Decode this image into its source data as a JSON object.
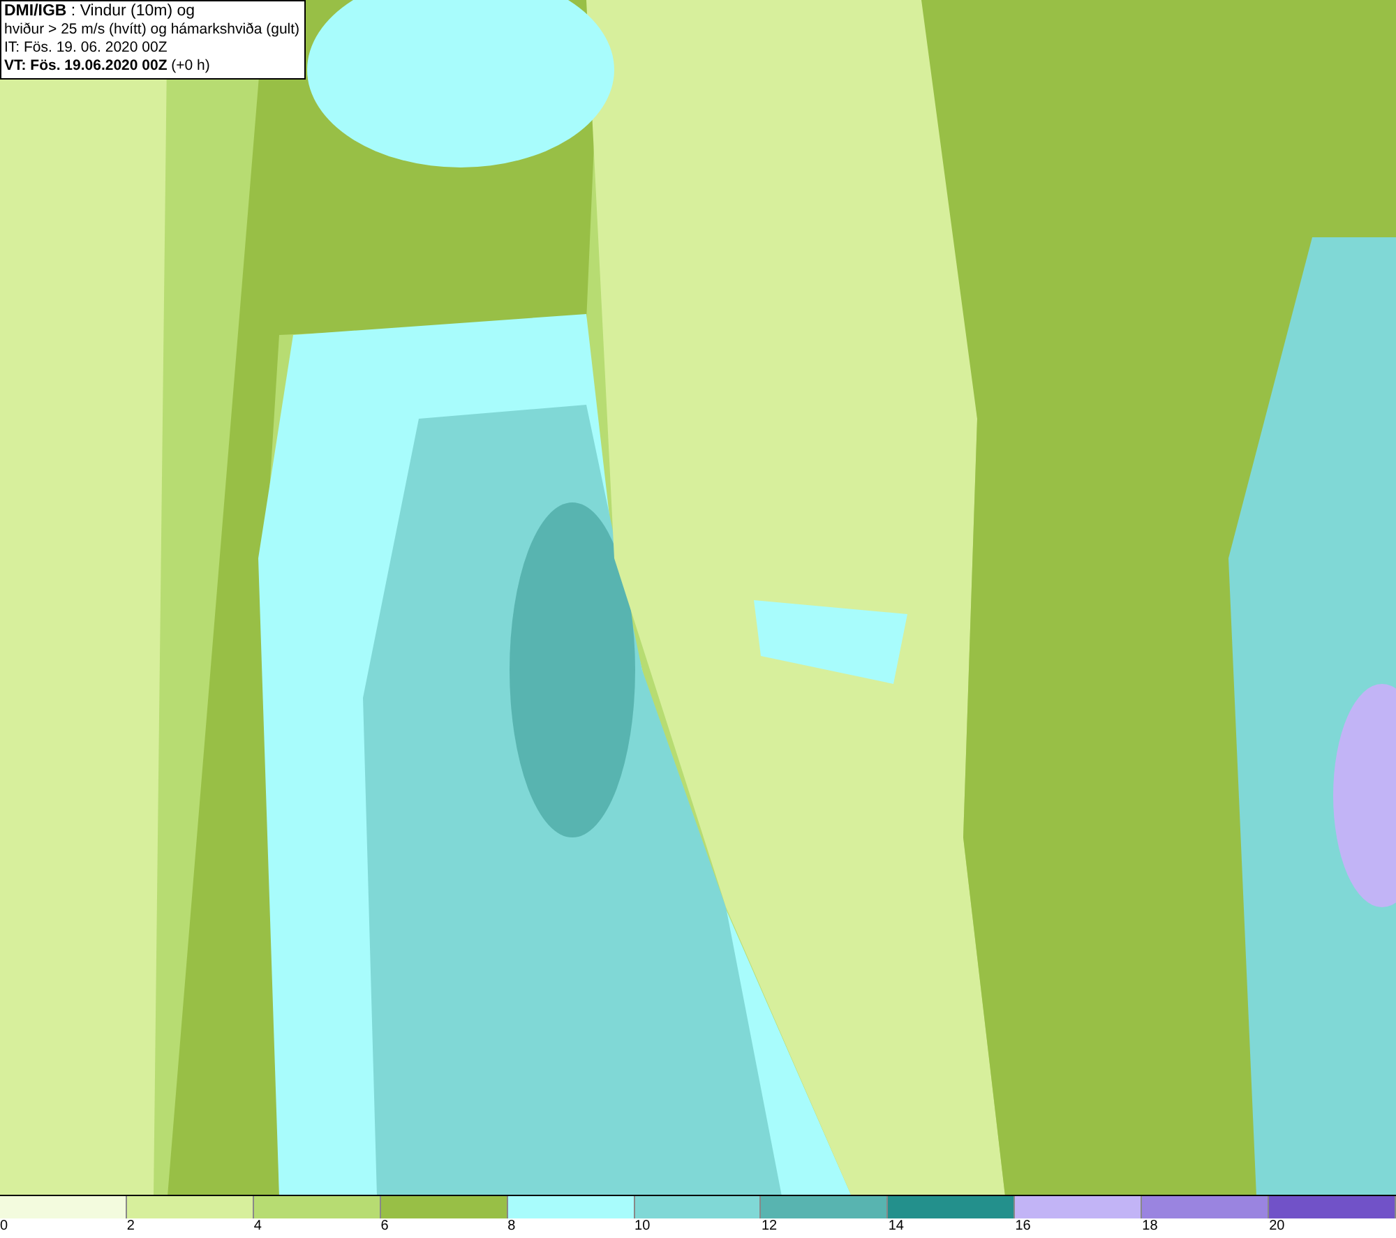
{
  "info_box": {
    "lines": [
      "**DMI/IGB** : Vindur (10m) og",
      "hviður > 25 m/s (hvítt) og hámarkshviða (gult)",
      "IT: Fös. 19. 06. 2020 00Z",
      "**VT: Fös. 19.06.2020 00Z** (+0 h)"
    ]
  },
  "legend": {
    "bins": [
      {
        "color": "#f3fbde",
        "label": "0"
      },
      {
        "color": "#d7ef9c",
        "label": "2"
      },
      {
        "color": "#b7dc72",
        "label": "4"
      },
      {
        "color": "#98bf46",
        "label": "6"
      },
      {
        "color": "#a8fcfc",
        "label": "8"
      },
      {
        "color": "#80d8d6",
        "label": "10"
      },
      {
        "color": "#58b4b0",
        "label": "12"
      },
      {
        "color": "#23908c",
        "label": "14"
      },
      {
        "color": "#c2b4f6",
        "label": "16"
      },
      {
        "color": "#9a84e0",
        "label": "18"
      },
      {
        "color": "#7152c8",
        "label": "20"
      }
    ]
  }
}
